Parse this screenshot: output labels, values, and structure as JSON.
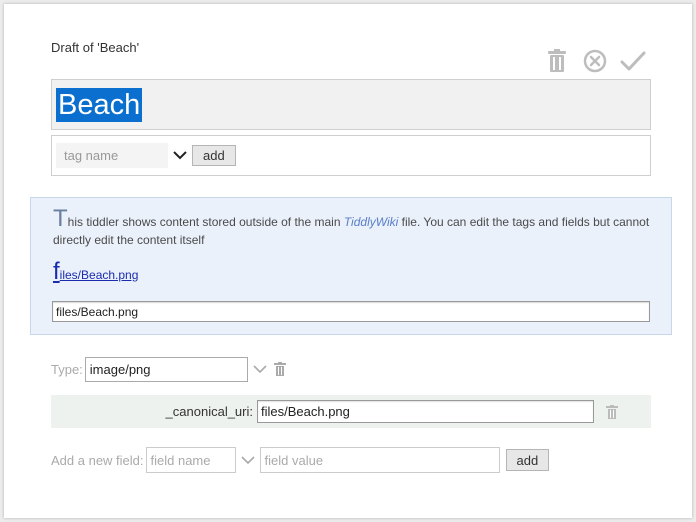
{
  "draft_title": "Draft of 'Beach'",
  "toolbar": {
    "delete_icon": "trash-icon",
    "cancel_icon": "circle-x-icon",
    "done_icon": "check-icon"
  },
  "title_value": "Beach",
  "tags": {
    "placeholder": "tag name",
    "add_label": "add"
  },
  "info": {
    "dropcap": "T",
    "text_before": "his tiddler shows content stored outside of the main ",
    "link_text": "TiddlyWiki",
    "text_after": " file. You can edit the tags and fields but cannot directly edit the content itself",
    "file_dropcap": "f",
    "file_link_rest": "iles/Beach.png",
    "file_input_value": "files/Beach.png"
  },
  "type": {
    "label": "Type:",
    "value": "image/png"
  },
  "fields": [
    {
      "name": "_canonical_uri:",
      "value": "files/Beach.png"
    }
  ],
  "new_field": {
    "label": "Add a new field:",
    "name_placeholder": "field name",
    "value_placeholder": "field value",
    "add_label": "add"
  },
  "colors": {
    "selection": "#0a6fcf",
    "info_bg": "#eaf1fb",
    "field_row_bg": "#eef2ee",
    "link": "#1a2bb0"
  }
}
